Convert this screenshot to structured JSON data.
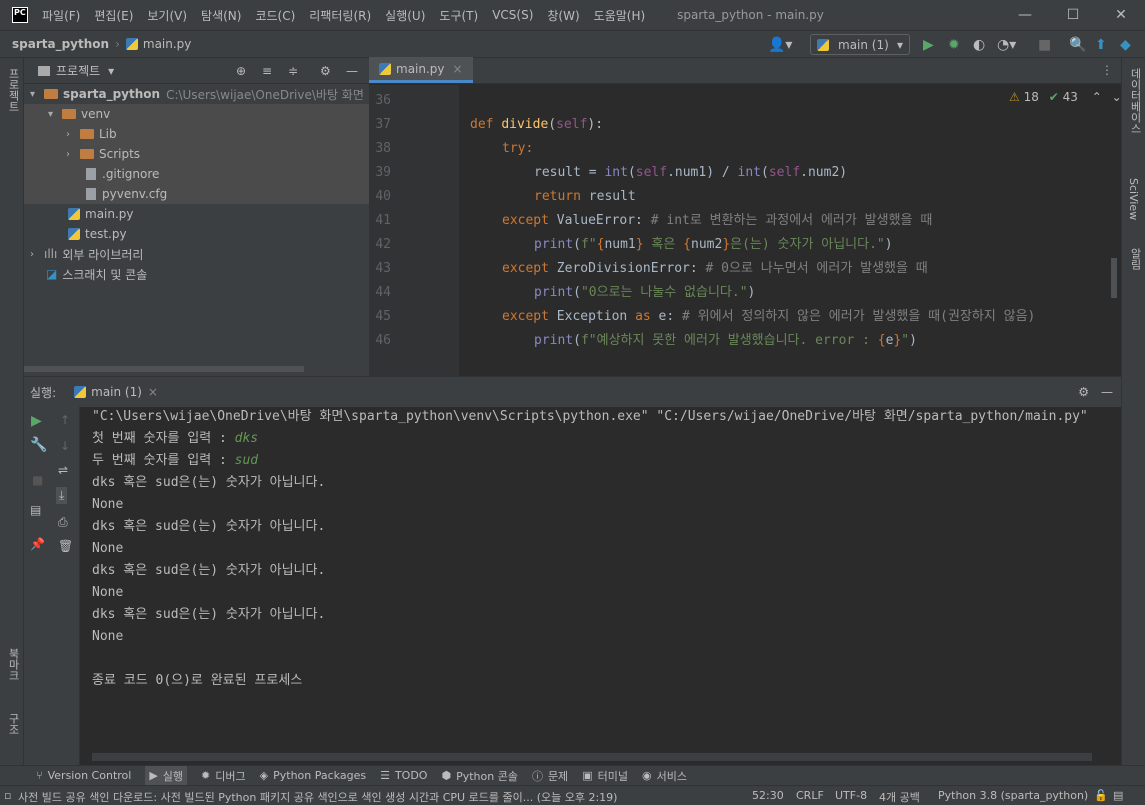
{
  "app": {
    "logo": "PC",
    "menu": [
      "파일(F)",
      "편집(E)",
      "보기(V)",
      "탐색(N)",
      "코드(C)",
      "리팩터링(R)",
      "실행(U)",
      "도구(T)",
      "VCS(S)",
      "창(W)",
      "도움말(H)"
    ],
    "window_title": "sparta_python - main.py"
  },
  "nav": {
    "project": "sparta_python",
    "file": "main.py",
    "run_config": "main (1)"
  },
  "left_strip": {
    "project": "프로젝트",
    "bookmarks": "북마크",
    "structure": "구조"
  },
  "right_strip": {
    "db": "데이터베이스",
    "sciview": "SciView",
    "notifications": "알림"
  },
  "project_panel": {
    "title": "프로젝트",
    "tree": [
      {
        "label": "sparta_python",
        "path": "C:\\Users\\wijae\\OneDrive\\바탕 화면"
      },
      {
        "label": "venv"
      },
      {
        "label": "Lib"
      },
      {
        "label": "Scripts"
      },
      {
        "label": ".gitignore"
      },
      {
        "label": "pyvenv.cfg"
      },
      {
        "label": "main.py"
      },
      {
        "label": "test.py"
      },
      {
        "label": "외부 라이브러리"
      },
      {
        "label": "스크래치 및 콘솔"
      }
    ]
  },
  "editor": {
    "tab": "main.py",
    "warnings": "18",
    "checks": "43",
    "lines": [
      {
        "n": "36",
        "code": ""
      },
      {
        "n": "37",
        "code": "def divide(self):"
      },
      {
        "n": "38",
        "code": "try:"
      },
      {
        "n": "39",
        "code": "result = int(self.num1) / int(self.num2)"
      },
      {
        "n": "40",
        "code": "return result"
      },
      {
        "n": "41",
        "code": "except ValueError: # int로 변환하는 과정에서 에러가 발생했을 때"
      },
      {
        "n": "42",
        "code": "print(f\"{num1} 혹은 {num2}은(는) 숫자가 아닙니다.\")"
      },
      {
        "n": "43",
        "code": "except ZeroDivisionError: # 0으로 나누면서 에러가 발생했을 때"
      },
      {
        "n": "44",
        "code": "print(\"0으로는 나눌수 없습니다.\")"
      },
      {
        "n": "45",
        "code": "except Exception as e: # 위에서 정의하지 않은 에러가 발생했을 때(권장하지 않음)"
      },
      {
        "n": "46",
        "code": "print(f\"예상하지 못한 에러가 발생했습니다. error : {e}\")"
      }
    ]
  },
  "run": {
    "label": "실행:",
    "tab": "main (1)",
    "output": [
      "\"C:\\Users\\wijae\\OneDrive\\바탕 화면\\sparta_python\\venv\\Scripts\\python.exe\" \"C:/Users/wijae/OneDrive/바탕 화면/sparta_python/main.py\"",
      "첫 번째 숫자를 입력 : ",
      "두 번째 숫자를 입력 : ",
      "dks 혹은 sud은(는) 숫자가 아닙니다.",
      "None",
      "dks 혹은 sud은(는) 숫자가 아닙니다.",
      "None",
      "dks 혹은 sud은(는) 숫자가 아닙니다.",
      "None",
      "dks 혹은 sud은(는) 숫자가 아닙니다.",
      "None",
      "",
      "종료 코드 0(으)로 완료된 프로세스"
    ],
    "input1": "dks",
    "input2": "sud"
  },
  "bottom_tabs": [
    "Version Control",
    "실행",
    "디버그",
    "Python Packages",
    "TODO",
    "Python 콘솔",
    "문제",
    "터미널",
    "서비스"
  ],
  "status": {
    "message": "사전 빌드 공유 색인 다운로드: 사전 빌드된 Python 패키지 공유 색인으로 색인 생성 시간과 CPU 로드를 줄이... (오늘 오후 2:19)",
    "position": "52:30",
    "line_sep": "CRLF",
    "encoding": "UTF-8",
    "indent": "4개 공백",
    "interpreter": "Python 3.8 (sparta_python)"
  }
}
